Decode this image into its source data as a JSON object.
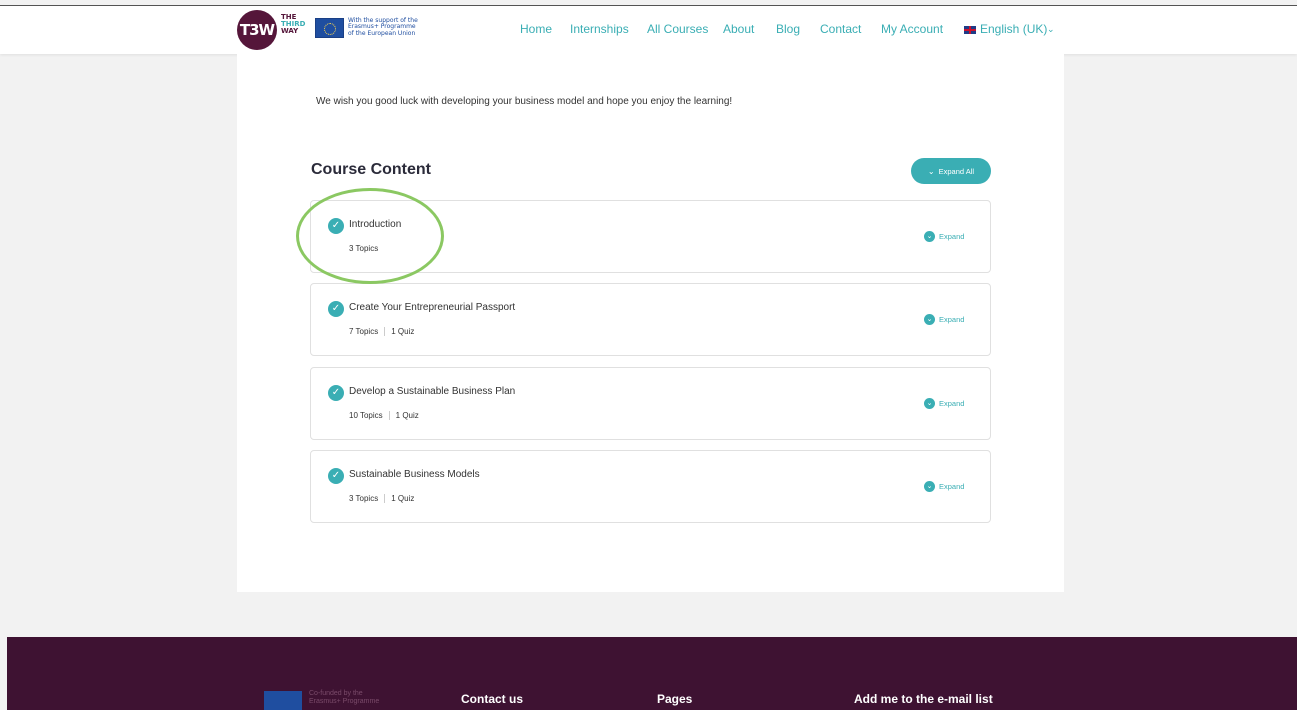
{
  "header": {
    "logo_mark": "T3W",
    "logo_text": [
      "THE",
      "THIRD",
      "WAY"
    ],
    "eu_text": [
      "With the support of the",
      "Erasmus+ Programme",
      "of the European Union"
    ],
    "nav": [
      "Home",
      "Internships",
      "All Courses",
      "About",
      "Blog",
      "Contact",
      "My Account"
    ],
    "language": "English (UK)"
  },
  "intro_text": "We wish you good luck with developing your business model and hope you enjoy the learning!",
  "course_content": {
    "title": "Course Content",
    "expand_all_label": "Expand All",
    "lessons": [
      {
        "title": "Introduction",
        "topics": "3 Topics",
        "quiz": "",
        "expand_label": "Expand"
      },
      {
        "title": "Create Your Entrepreneurial Passport",
        "topics": "7 Topics",
        "quiz": "1 Quiz",
        "expand_label": "Expand"
      },
      {
        "title": "Develop a Sustainable Business Plan",
        "topics": "10 Topics",
        "quiz": "1 Quiz",
        "expand_label": "Expand"
      },
      {
        "title": "Sustainable Business Models",
        "topics": "3 Topics",
        "quiz": "1 Quiz",
        "expand_label": "Expand"
      }
    ]
  },
  "footer": {
    "eu_text": [
      "Co-funded by the",
      "Erasmus+ Programme"
    ],
    "columns": [
      "Contact us",
      "Pages",
      "Add me to the e-mail list"
    ]
  },
  "colors": {
    "accent": "#3aaeb4",
    "brand": "#55163a",
    "footer_bg": "#3e1232",
    "highlight": "#8bc862"
  }
}
